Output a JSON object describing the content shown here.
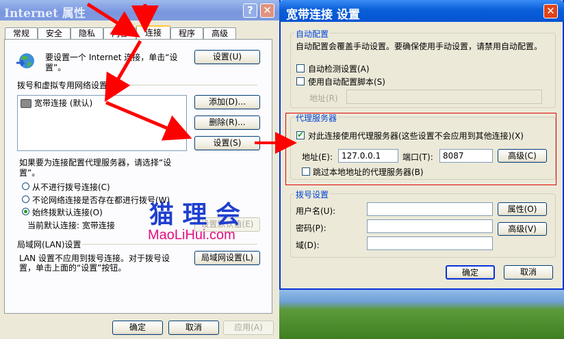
{
  "left_window": {
    "title": "Internet 属性",
    "caption_buttons": {
      "help": "?",
      "close": "✕"
    },
    "tabs": [
      "常规",
      "安全",
      "隐私",
      "内容",
      "连接",
      "程序",
      "高级"
    ],
    "active_tab": "连接",
    "setup_text": "要设置一个 Internet 连接，单击“设置”。",
    "setup_button": "设置(U)",
    "dialup_section_label": "拨号和虚拟专用网络设置",
    "connections": [
      {
        "label": "宽带连接 (默认)"
      }
    ],
    "add_button": "添加(D)...",
    "remove_button": "删除(R)...",
    "settings_button": "设置(S)",
    "proxy_hint": "如果要为连接配置代理服务器，请选择“设置”。",
    "radio_options": [
      {
        "label": "从不进行拨号连接(C)",
        "selected": false
      },
      {
        "label": "不论网络连接是否存在都进行拨号(W)",
        "selected": false
      },
      {
        "label": "始终拨默认连接(O)",
        "selected": true
      }
    ],
    "current_default_label": "当前默认连接:  宽带连接",
    "set_default_button": "设置默认值(E)",
    "lan_section_label": "局域网(LAN)设置",
    "lan_text_1": "LAN 设置不应用到拨号连接。对于拨号设",
    "lan_text_2": "置，单击上面的“设置”按钮。",
    "lan_button": "局域网设置(L)",
    "footer": {
      "ok": "确定",
      "cancel": "取消",
      "apply": "应用(A)"
    }
  },
  "right_window": {
    "title": "宽带连接 设置",
    "caption_buttons": {
      "close": "✕"
    },
    "auto_config": {
      "group_label": "自动配置",
      "description": "自动配置会覆盖手动设置。要确保使用手动设置，请禁用自动配置。",
      "auto_detect": {
        "label": "自动检测设置(A)",
        "checked": false
      },
      "auto_script": {
        "label": "使用自动配置脚本(S)",
        "checked": false
      },
      "address_label": "地址(R)",
      "address_value": ""
    },
    "proxy": {
      "group_label": "代理服务器",
      "use_proxy": {
        "label": "对此连接使用代理服务器(这些设置不会应用到其他连接)(X)",
        "checked": true
      },
      "address_label": "地址(E):",
      "address_value": "127.0.0.1",
      "port_label": "端口(T):",
      "port_value": "8087",
      "advanced_button": "高级(C)",
      "bypass_local": {
        "label": "跳过本地地址的代理服务器(B)",
        "checked": false
      }
    },
    "dialup": {
      "group_label": "拨号设置",
      "username_label": "用户名(U):",
      "username_value": "",
      "password_label": "密码(P):",
      "password_value": "",
      "domain_label": "域(D):",
      "domain_value": "",
      "properties_button": "属性(O)",
      "advanced_button": "高级(V)"
    },
    "footer": {
      "ok": "确定",
      "cancel": "取消"
    }
  },
  "watermark": {
    "cn": "猫 理 会",
    "en": "MaoLiHui.com"
  },
  "colors": {
    "title_bar": "#0a5fd8",
    "close_button": "#e04319",
    "arrow": "#ff0000",
    "tab_highlight": "#ffc83c"
  }
}
